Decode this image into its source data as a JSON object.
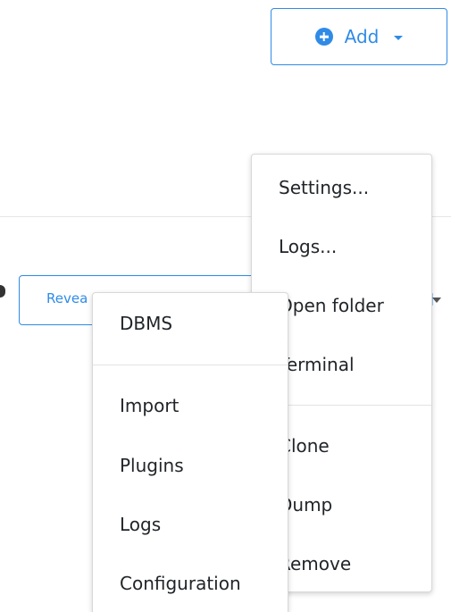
{
  "header": {
    "add_button": {
      "label": "Add",
      "icon": "plus-circle-icon",
      "accent_color": "#2f8be6"
    }
  },
  "toolbar": {
    "reveal_label": "Revea"
  },
  "project_menu": {
    "items": [
      "Settings...",
      "Logs...",
      "Open folder",
      "Terminal",
      "Clone",
      "Dump",
      "Remove"
    ]
  },
  "main_menu": {
    "items": [
      "DBMS",
      "Import",
      "Plugins",
      "Logs",
      "Configuration"
    ]
  }
}
